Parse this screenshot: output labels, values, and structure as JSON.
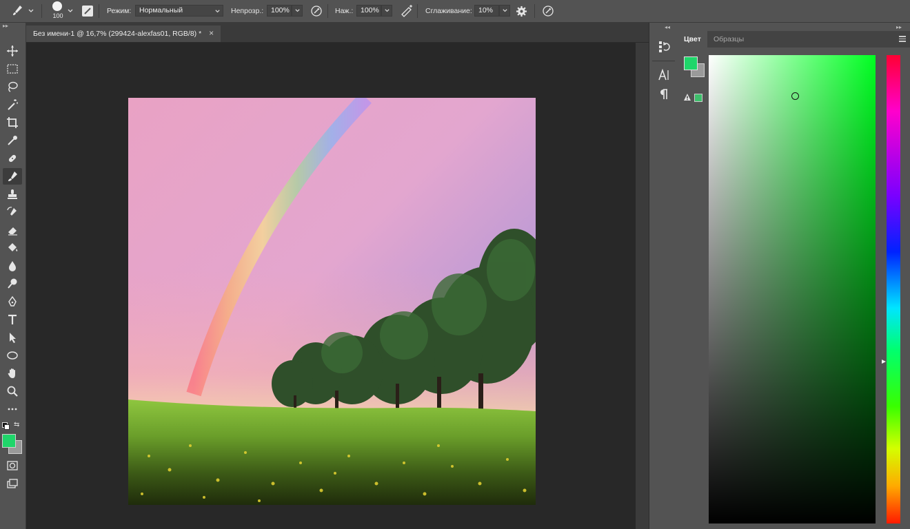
{
  "options_bar": {
    "brush_size": "100",
    "mode_label": "Режим:",
    "mode_value": "Нормальный",
    "opacity_label": "Непрозр.:",
    "opacity_value": "100%",
    "pressure_label": "Наж.:",
    "pressure_value": "100%",
    "smoothing_label": "Сглаживание:",
    "smoothing_value": "10%"
  },
  "document": {
    "tab_title": "Без имени-1 @ 16,7% (299424-alexfas01, RGB/8) *",
    "close_glyph": "×"
  },
  "panel": {
    "tabs": [
      {
        "label": "Цвет",
        "active": true
      },
      {
        "label": "Образцы",
        "active": false
      }
    ],
    "foreground_color": "#1fd66a",
    "background_color": "#9a9a9a",
    "hue_marker_level": 0.65
  },
  "toolbar": {
    "foreground_color": "#1fd66a",
    "background_color": "#9a9a9a",
    "tools": [
      "move",
      "marquee",
      "lasso",
      "magic-wand",
      "crop",
      "eyedropper",
      "healing-brush",
      "brush",
      "clone-stamp",
      "history-brush",
      "eraser",
      "paint-bucket",
      "blur",
      "dodge",
      "pen",
      "type",
      "path-selection",
      "ellipse",
      "hand",
      "zoom",
      "more"
    ],
    "active_tool": "brush"
  },
  "colors": {
    "ui_dark": "#282828",
    "ui_panel": "#535353",
    "accent_green": "#1fd66a"
  }
}
